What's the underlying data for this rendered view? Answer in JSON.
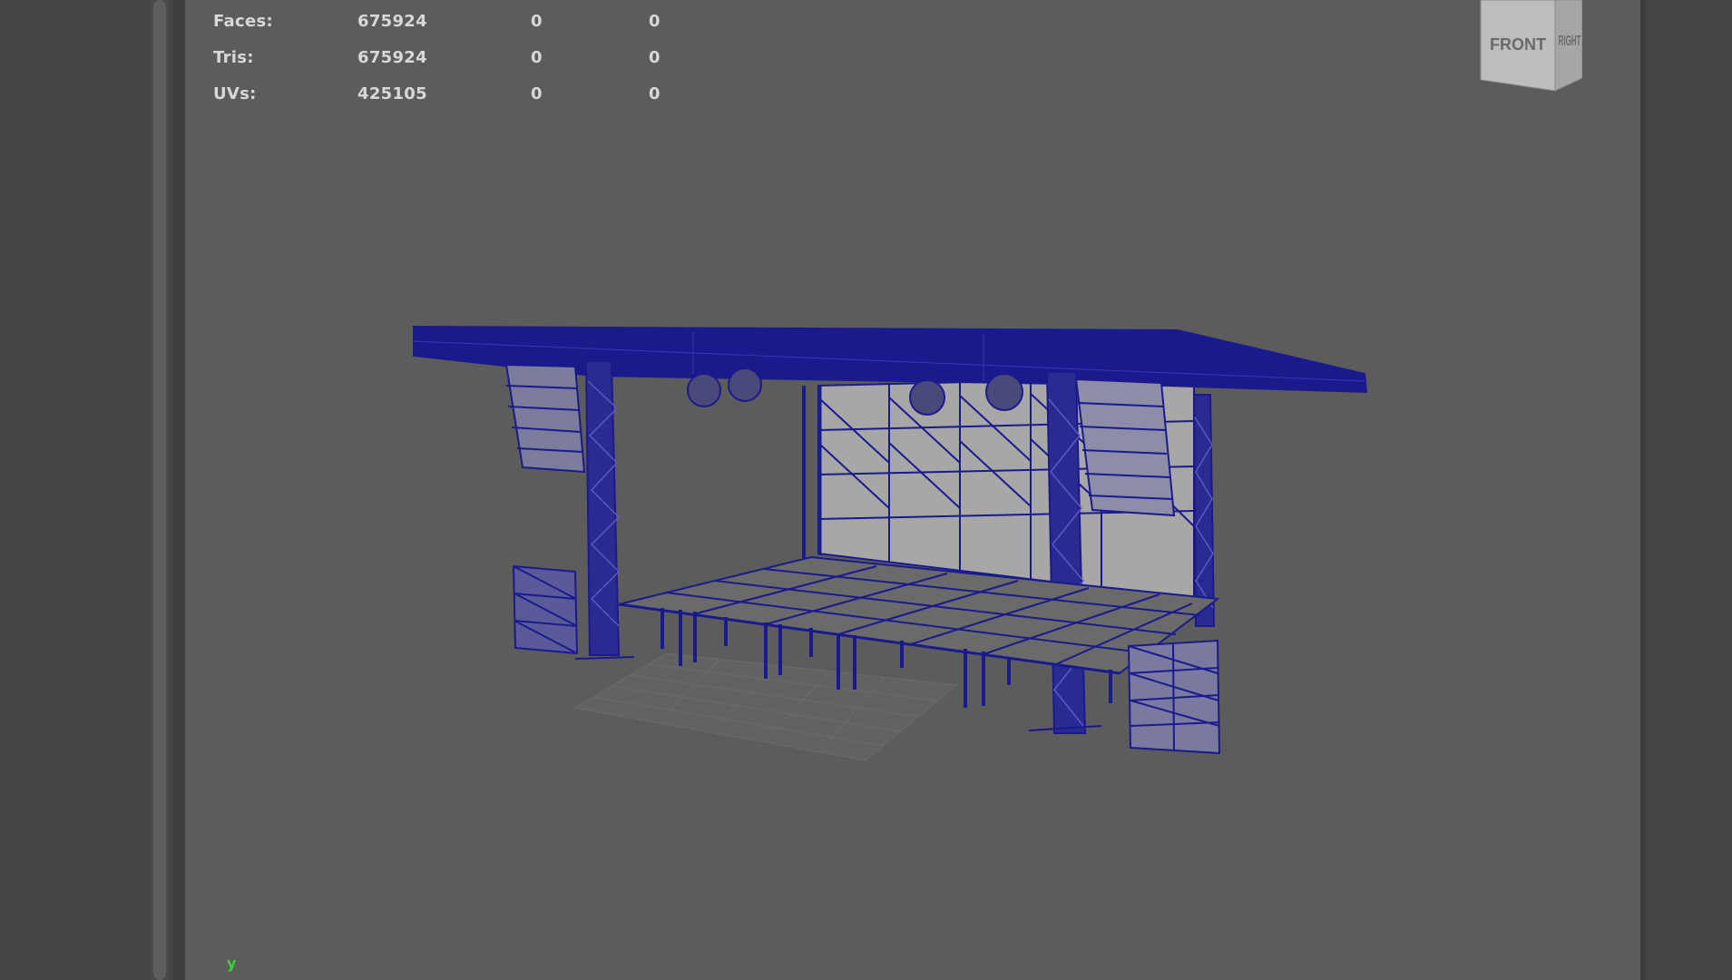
{
  "hud": {
    "rows": [
      {
        "label": "Faces:",
        "v1": "675924",
        "v2": "0",
        "v3": "0"
      },
      {
        "label": "Tris:",
        "v1": "675924",
        "v2": "0",
        "v3": "0"
      },
      {
        "label": "UVs:",
        "v1": "425105",
        "v2": "0",
        "v3": "0"
      }
    ]
  },
  "viewcube": {
    "front_label": "FRONT",
    "right_label": "RIGHT"
  },
  "axis_indicator": {
    "label": "y"
  },
  "colors": {
    "wireframe": "#1a1a8c",
    "viewport_bg": "#5c5c5c",
    "hud_text": "#d8d8d8",
    "axis_y": "#37d637"
  }
}
